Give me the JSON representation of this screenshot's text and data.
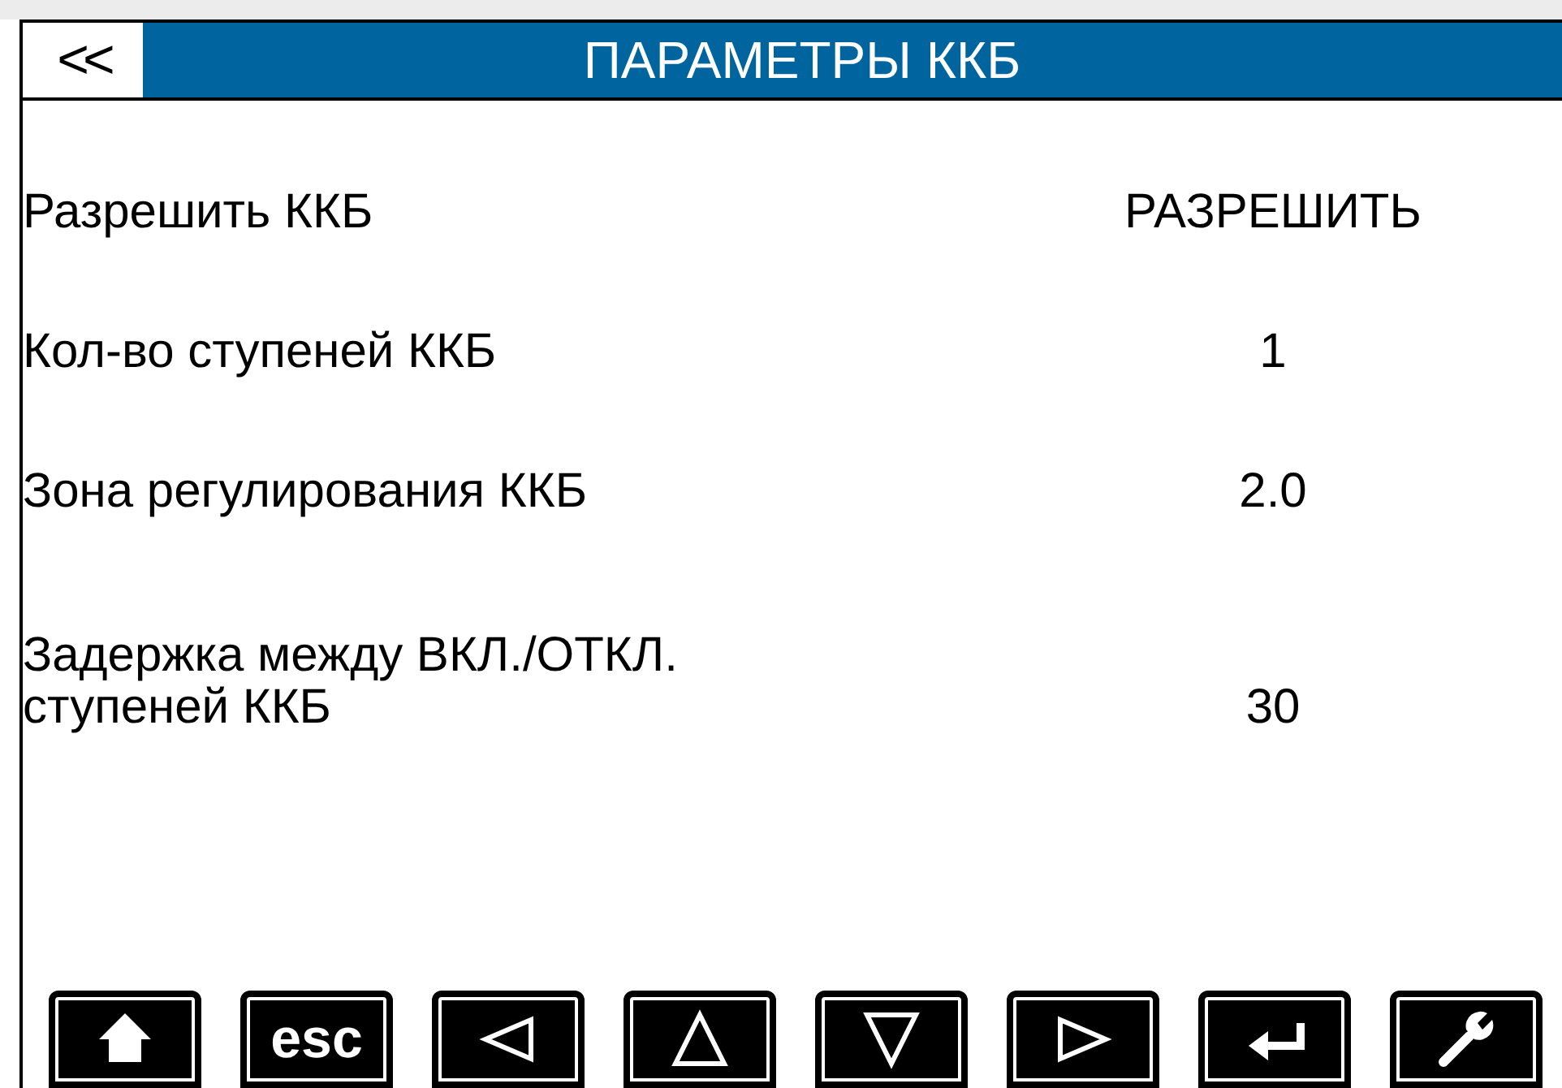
{
  "header": {
    "back": "<<",
    "title": "ПАРАМЕТРЫ ККБ"
  },
  "params": [
    {
      "label": "Разрешить ККБ",
      "value": "РАЗРЕШИТЬ"
    },
    {
      "label": "Кол-во ступеней ККБ",
      "value": "1"
    },
    {
      "label": "Зона регулирования ККБ",
      "value": "2.0"
    },
    {
      "label": "Задержка между ВКЛ./ОТКЛ.\nступеней ККБ",
      "value": "30"
    }
  ],
  "keys": [
    {
      "kind": "home"
    },
    {
      "kind": "text",
      "label": "esc"
    },
    {
      "kind": "left"
    },
    {
      "kind": "up"
    },
    {
      "kind": "down"
    },
    {
      "kind": "right"
    },
    {
      "kind": "enter"
    },
    {
      "kind": "wrench"
    }
  ]
}
